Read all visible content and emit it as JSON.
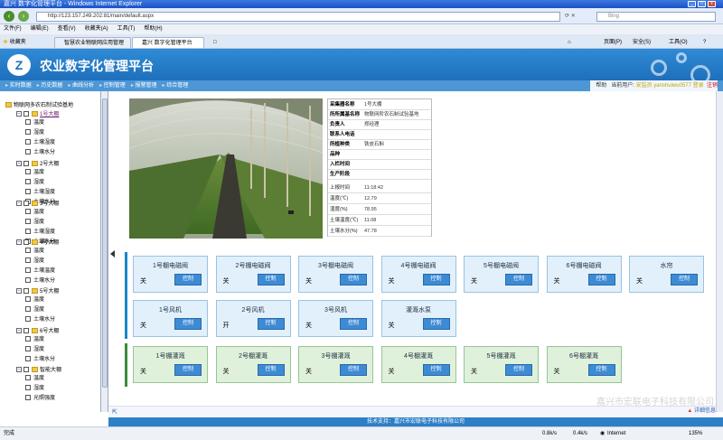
{
  "window": {
    "title": "嘉兴 数字化管理平台 - Windows Internet Explorer"
  },
  "addressbar": {
    "url": "http://123.157.249.202:81/main/default.aspx",
    "search_placeholder": "Bing"
  },
  "menu": [
    "文件(F)",
    "编辑(E)",
    "查看(V)",
    "收藏夹(A)",
    "工具(T)",
    "帮助(H)"
  ],
  "favorites_label": "收藏夹",
  "tabs": [
    {
      "label": "智慧农业物联网应用管理"
    },
    {
      "label": "嘉兴 数字化管理平台"
    }
  ],
  "tab_tools": {
    "home": "主页(M)",
    "page": "页面(P)",
    "safety": "安全(S)",
    "tools": "工具(O)",
    "help": "?"
  },
  "app": {
    "title": "农业数字化管理平台",
    "logo": "Z"
  },
  "nav": [
    "实时数据",
    "历史数据",
    "曲线分析",
    "控制管理",
    "报警管理",
    "综合管理"
  ],
  "user": {
    "help": "帮助",
    "current_label": "当前用户:",
    "name": "安监员 yanshuiwu0577 登录",
    "logout": "注销"
  },
  "tree": {
    "root": "物联网多农石制试验基地",
    "groups": [
      {
        "label": "1号大棚",
        "items": [
          "温度",
          "湿度",
          "土壤湿度",
          "土壤水分"
        ]
      },
      {
        "label": "2号大棚",
        "items": [
          "温度",
          "湿度",
          "土壤湿度",
          "土壤水分"
        ]
      },
      {
        "label": "3号大棚",
        "items": [
          "温度",
          "湿度",
          "土壤湿度",
          "土壤水分"
        ]
      },
      {
        "label": "4号大棚",
        "items": [
          "温度",
          "湿度",
          "土壤温度",
          "土壤水分"
        ]
      },
      {
        "label": "5号大棚",
        "items": [
          "温度",
          "湿度",
          "土壤水分"
        ]
      },
      {
        "label": "6号大棚",
        "items": [
          "温度",
          "湿度",
          "土壤水分"
        ]
      },
      {
        "label": "智能大棚",
        "items": [
          "温度",
          "湿度",
          "光照强度"
        ]
      }
    ]
  },
  "info": {
    "rows": [
      {
        "label": "采集器名称",
        "value": "1号大棚"
      },
      {
        "label": "所所属基名称",
        "value": "物联网阶农石制试验基地"
      },
      {
        "label": "负责人",
        "value": "郑经理"
      },
      {
        "label": "联系人电话",
        "value": ""
      },
      {
        "label": "所植种类",
        "value": "铁皮石斛"
      },
      {
        "label": "品种",
        "value": ""
      },
      {
        "label": "入栏时间",
        "value": ""
      },
      {
        "label": "生产阶段",
        "value": ""
      }
    ],
    "sensors": [
      {
        "label": "上报时间",
        "value": "11:18:42"
      },
      {
        "label": "温度(℃)",
        "value": "12.79"
      },
      {
        "label": "湿度(%)",
        "value": "78.95"
      },
      {
        "label": "土壤温度(℃)",
        "value": "11.08"
      },
      {
        "label": "土壤水分(%)",
        "value": "47.78"
      }
    ]
  },
  "controls_row1": [
    {
      "title": "1号棚电磁阀",
      "state": "关",
      "button": "控制"
    },
    {
      "title": "2号棚电磁阀",
      "state": "关",
      "button": "控制"
    },
    {
      "title": "3号棚电磁阀",
      "state": "关",
      "button": "控制"
    },
    {
      "title": "4号棚电磁阀",
      "state": "关",
      "button": "控制"
    },
    {
      "title": "5号棚电磁阀",
      "state": "关",
      "button": "控制"
    },
    {
      "title": "6号棚电磁阀",
      "state": "关",
      "button": "控制"
    },
    {
      "title": "水帘",
      "state": "关",
      "button": "控制"
    }
  ],
  "controls_row2": [
    {
      "title": "1号风机",
      "state": "关",
      "button": "控制"
    },
    {
      "title": "2号风机",
      "state": "开",
      "button": "控制"
    },
    {
      "title": "3号风机",
      "state": "关",
      "button": "控制"
    },
    {
      "title": "灌溉水泵",
      "state": "关",
      "button": "控制"
    }
  ],
  "controls_row3": [
    {
      "title": "1号棚灌溉",
      "state": "关",
      "button": "控制"
    },
    {
      "title": "2号棚灌溉",
      "state": "关",
      "button": "控制"
    },
    {
      "title": "3号棚灌溉",
      "state": "关",
      "button": "控制"
    },
    {
      "title": "4号棚灌溉",
      "state": "关",
      "button": "控制"
    },
    {
      "title": "5号棚灌溉",
      "state": "关",
      "button": "控制"
    },
    {
      "title": "6号棚灌溉",
      "state": "关",
      "button": "控制"
    }
  ],
  "footer": "技术支持：嘉兴市宏联电子科技有限公司",
  "watermark": "嘉兴市宏联电子科技有限公司",
  "detail_link": "详细信息",
  "status": {
    "left": "完成",
    "zone": "Internet",
    "zoom": "135%",
    "sec1": "0.8k/s",
    "sec2": "0.4k/s"
  },
  "colors": {
    "brand": "#1f6fbb",
    "nav": "#4d97d6",
    "active_button": "#3d8bd4",
    "irrigation_bg": "#dff1da",
    "valve_bg": "#e2f0fb"
  }
}
